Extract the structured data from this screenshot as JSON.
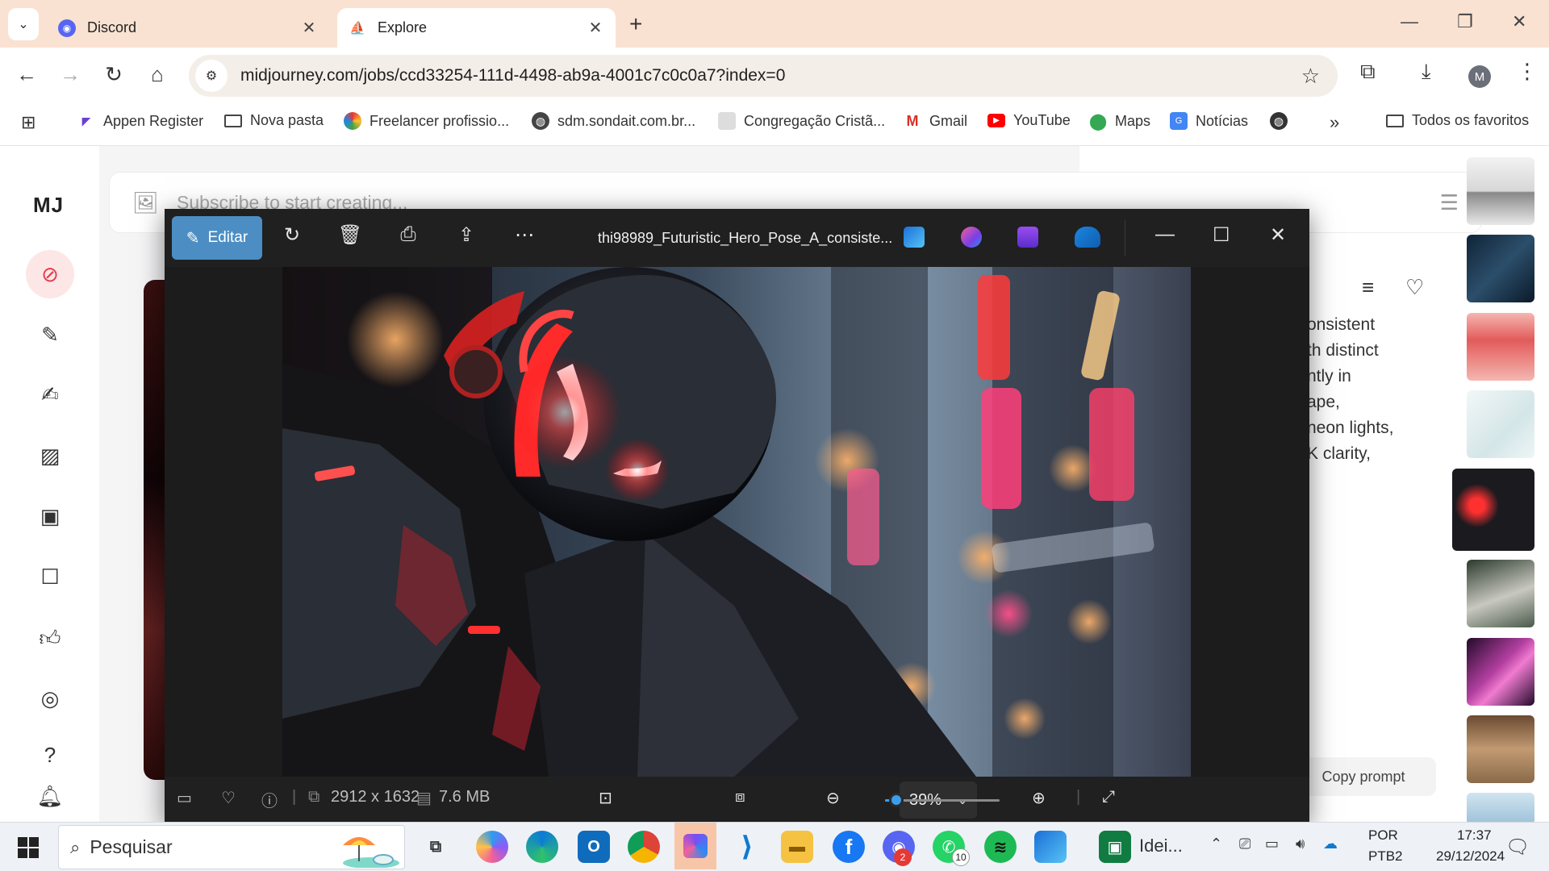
{
  "browser": {
    "tabs": [
      {
        "label": "Discord",
        "active": false
      },
      {
        "label": "Explore",
        "active": true
      }
    ],
    "url": "midjourney.com/jobs/ccd33254-111d-4498-ab9a-4001c7c0c0a7?index=0",
    "profile_initial": "M"
  },
  "bookmarks": [
    {
      "label": "Appen Register",
      "icon": "appen-icon"
    },
    {
      "label": "Nova pasta",
      "icon": "folder-icon"
    },
    {
      "label": "Freelancer profissio...",
      "icon": "freelancer-icon"
    },
    {
      "label": "sdm.sondait.com.br...",
      "icon": "globe-icon"
    },
    {
      "label": "Congregação Cristã...",
      "icon": "ccb-icon"
    },
    {
      "label": "Gmail",
      "icon": "gmail-icon"
    },
    {
      "label": "YouTube",
      "icon": "youtube-icon"
    },
    {
      "label": "Maps",
      "icon": "maps-icon"
    },
    {
      "label": "Notícias",
      "icon": "news-icon"
    }
  ],
  "bookmarks_all": "Todos os favoritos",
  "midjourney": {
    "logo": "MJ",
    "prompt_placeholder": "Subscribe to start creating...",
    "description_lines": [
      "onsistent",
      "th distinct",
      "ntly in",
      "ape,",
      "neon lights,",
      "K clarity,"
    ],
    "copy_prompt": "Copy prompt"
  },
  "viewer": {
    "edit_label": "Editar",
    "title": "thi98989_Futuristic_Hero_Pose_A_consiste...",
    "dimensions": "2912 x 1632",
    "file_size": "7.6 MB",
    "zoom": "39%",
    "zoom_fraction": 0.1
  },
  "taskbar": {
    "search_placeholder": "Pesquisar",
    "pinned_label": "Idei...",
    "whatsapp_badge": "10",
    "discord_badge": "2",
    "language": "POR",
    "keyboard": "PTB2",
    "time": "17:37",
    "date": "29/12/2024"
  },
  "colors": {
    "tabstrip": "#f9e2d2",
    "viewer_bg": "#1c1c1c",
    "edit_accent": "#4c8ec4",
    "mj_active": "#e53b4b"
  }
}
